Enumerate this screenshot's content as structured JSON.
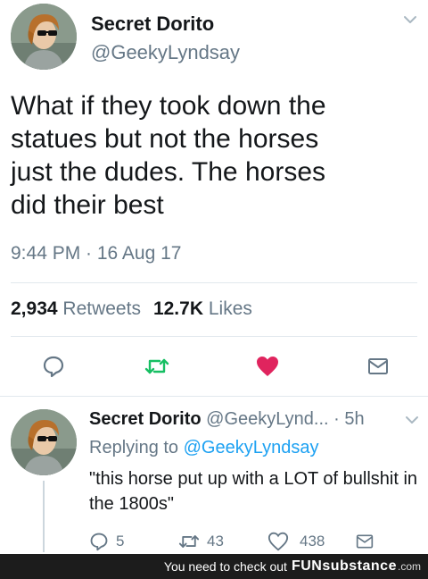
{
  "tweet": {
    "display_name": "Secret Dorito",
    "handle": "@GeekyLyndsay",
    "text": "What if they took down the\nstatues but not the horses\njust the dudes. The horses\ndid their best",
    "timestamp": "9:44 PM · 16 Aug 17",
    "retweets_count": "2,934",
    "retweets_label": "Retweets",
    "likes_count": "12.7K",
    "likes_label": "Likes",
    "liked": true,
    "colors": {
      "retweet_green": "#17bf63",
      "like_red": "#e0245e",
      "link_blue": "#1da1f2",
      "secondary_gray": "#657786"
    }
  },
  "reply": {
    "display_name": "Secret Dorito",
    "handle": "@GeekyLynd...",
    "time": "· 5h",
    "replying_prefix": "Replying to",
    "replying_handle": "@GeekyLyndsay",
    "text": "\"this horse put up with a LOT of bullshit in the 1800s\"",
    "reply_count": "5",
    "retweet_count": "43",
    "like_count": "438"
  },
  "icons": {
    "reply": "reply-icon",
    "retweet": "retweet-icon",
    "like": "heart-icon",
    "share": "share-mail-icon",
    "caret": "chevron-down-icon"
  },
  "footer": {
    "prefix": "You need to check out",
    "brand": "FUNsubstance",
    "domain": ".com"
  }
}
